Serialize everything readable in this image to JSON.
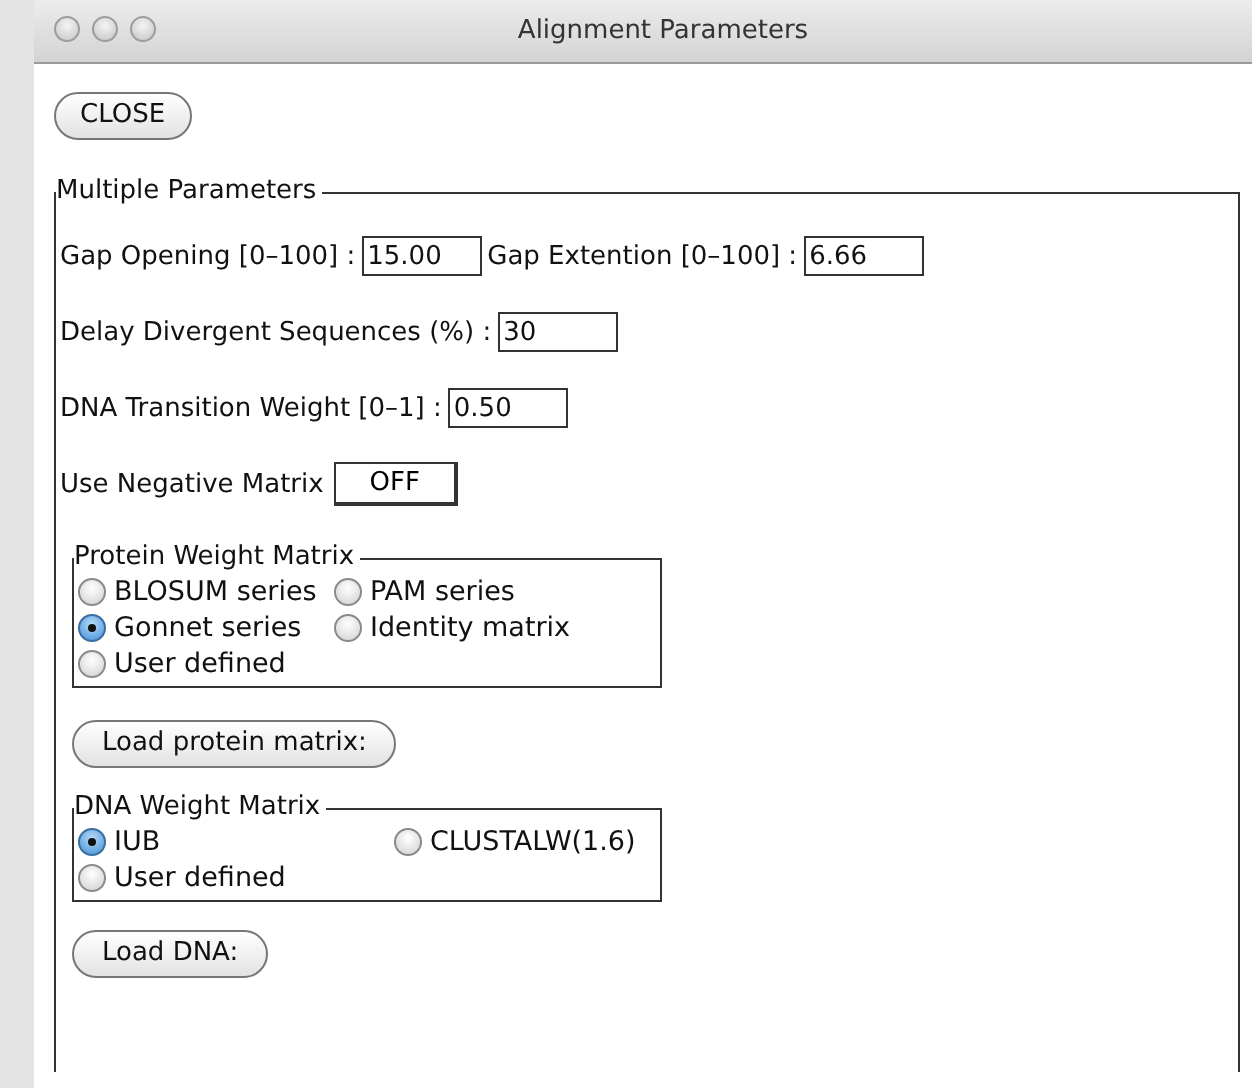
{
  "window": {
    "title": "Alignment Parameters"
  },
  "close_button": "CLOSE",
  "multiple_parameters": {
    "legend": "Multiple Parameters",
    "rows": [
      {
        "kind": "fields",
        "items": [
          {
            "label": "Gap Opening [0–100] :",
            "value": "15.00"
          },
          {
            "label": "Gap Extention [0–100] :",
            "value": "6.66"
          }
        ]
      },
      {
        "kind": "fields",
        "items": [
          {
            "label": "Delay Divergent Sequences (%) :",
            "value": "30"
          }
        ]
      },
      {
        "kind": "fields",
        "items": [
          {
            "label": "DNA Transition Weight [0–1] :",
            "value": "0.50"
          }
        ]
      },
      {
        "kind": "toggle",
        "label": "Use Negative Matrix",
        "value": "OFF"
      }
    ],
    "protein_weight_matrix": {
      "legend": "Protein Weight Matrix",
      "options": [
        {
          "label": "BLOSUM series",
          "selected": false
        },
        {
          "label": "PAM series",
          "selected": false
        },
        {
          "label": "Gonnet series",
          "selected": true
        },
        {
          "label": "Identity matrix",
          "selected": false
        },
        {
          "label": "User defined",
          "selected": false
        }
      ]
    },
    "load_protein_button": "Load protein matrix:",
    "dna_weight_matrix": {
      "legend": "DNA Weight Matrix",
      "options": [
        {
          "label": "IUB",
          "selected": true
        },
        {
          "label": "CLUSTALW(1.6)",
          "selected": false
        },
        {
          "label": "User defined",
          "selected": false
        }
      ]
    },
    "load_dna_button": "Load DNA:"
  }
}
